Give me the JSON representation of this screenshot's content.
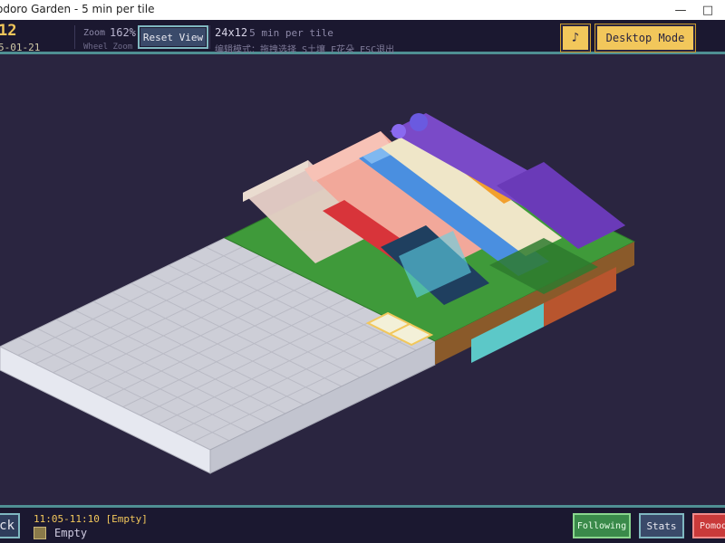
{
  "window": {
    "title": "odoro Garden - 5 min per tile",
    "minimize_icon": "minimize-icon",
    "maximize_icon": "maximize-icon"
  },
  "hud": {
    "time": "12",
    "date": "5-01-21",
    "zoom_label": "Zoom",
    "zoom_value": "162%",
    "wheel_zoom": "Wheel Zoom",
    "reset_view": "Reset View",
    "grid_size": "24x12",
    "per_tile": "5 min per tile",
    "edit_hint": "编辑模式：拖拽选择 S土壤 F花朵 ESC退出",
    "music_icon": "music-note-icon",
    "desktop_mode": "Desktop Mode"
  },
  "footer": {
    "back": "ck",
    "slot_time": "11:05-11:10 [Empty]",
    "slot_label": "Empty",
    "following": "Following",
    "stats": "Stats",
    "pomodoro": "Pomodo"
  },
  "colors": {
    "background": "#2a2540",
    "hud": "#1b1830",
    "accent": "#f2c75b",
    "border": "#4f8f93",
    "empty_tile": "#cfd0d8",
    "grass": "#3f9a3a",
    "soil": "#8a5a2a"
  }
}
